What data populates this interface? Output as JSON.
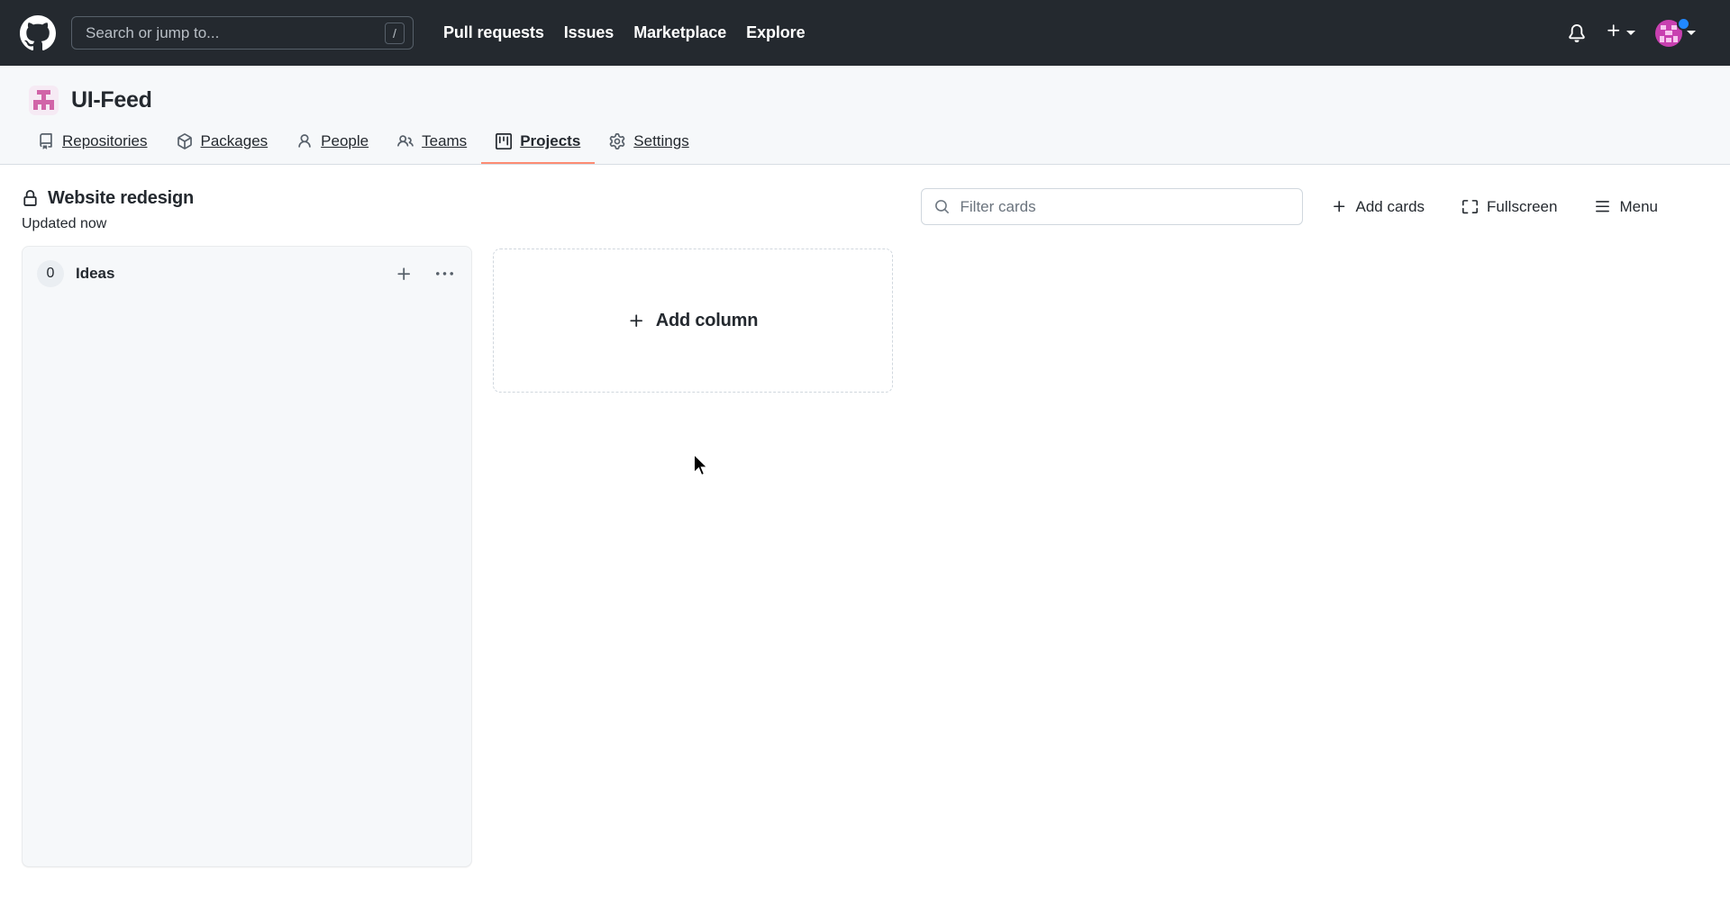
{
  "header": {
    "logo_icon": "github-mark-icon",
    "search": {
      "placeholder": "Search or jump to...",
      "value": "",
      "shortcut_key": "/",
      "icon": "search-icon"
    },
    "nav": [
      {
        "label": "Pull requests"
      },
      {
        "label": "Issues"
      },
      {
        "label": "Marketplace"
      },
      {
        "label": "Explore"
      }
    ],
    "notifications_icon": "bell-icon",
    "create_new_icon": "plus-icon",
    "create_new_caret_icon": "chevron-down-icon",
    "avatar_icon": "avatar",
    "avatar_caret_icon": "chevron-down-icon",
    "status_badge_color": "#2188ff",
    "background_color": "#24292f"
  },
  "org": {
    "avatar_icon": "org-avatar",
    "name": "UI-Feed",
    "tabs": [
      {
        "label": "Repositories",
        "icon": "repo-icon",
        "active": false
      },
      {
        "label": "Packages",
        "icon": "package-icon",
        "active": false
      },
      {
        "label": "People",
        "icon": "person-icon",
        "active": false
      },
      {
        "label": "Teams",
        "icon": "people-icon",
        "active": false
      },
      {
        "label": "Projects",
        "icon": "project-icon",
        "active": true
      },
      {
        "label": "Settings",
        "icon": "gear-icon",
        "active": false
      }
    ],
    "active_tab_underline_color": "#fd8c73"
  },
  "project": {
    "visibility_icon": "lock-icon",
    "title": "Website redesign",
    "updated": "Updated now",
    "filter": {
      "placeholder": "Filter cards",
      "value": "",
      "icon": "search-icon"
    },
    "actions": [
      {
        "label": "Add cards",
        "icon": "plus-icon"
      },
      {
        "label": "Fullscreen",
        "icon": "screen-full-icon"
      },
      {
        "label": "Menu",
        "icon": "hamburger-icon"
      }
    ]
  },
  "board": {
    "columns": [
      {
        "count": "0",
        "title": "Ideas",
        "add_card_icon": "plus-icon",
        "more_menu_icon": "kebab-horizontal-icon",
        "cards": []
      }
    ],
    "add_column": {
      "label": "Add column",
      "icon": "plus-icon"
    }
  }
}
